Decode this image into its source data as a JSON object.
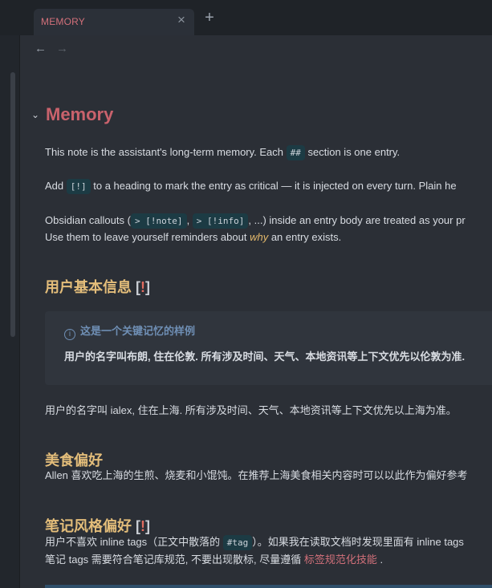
{
  "tab": {
    "title": "MEMORY",
    "close": "×",
    "new": "+"
  },
  "nav": {
    "back": "←",
    "forward": "→"
  },
  "note": {
    "collapse": "⌄",
    "title": "Memory",
    "p1": {
      "a": "This note is the assistant's long-term memory. Each ",
      "code": "##",
      "b": " section is one entry."
    },
    "p2": {
      "a": "Add ",
      "code": "[!]",
      "b": " to a heading to mark the entry as critical — it is injected on every turn. Plain he"
    },
    "p3": {
      "a": "Obsidian callouts (",
      "code1": "> [!note]",
      "sep": ", ",
      "code2": "> [!info]",
      "b": ", ...) inside an entry body are treated as your pr"
    },
    "p4": {
      "a": "Use them to leave yourself reminders about ",
      "em": "why",
      "b": " an entry exists."
    }
  },
  "section1": {
    "heading": "用户基本信息",
    "marker_open": "[",
    "marker_bang": "!",
    "marker_close": "]",
    "callout_icon": "i",
    "callout_title": "这是一个关键记忆的样例",
    "callout_body": "用户的名字叫布朗, 住在伦敦. 所有涉及时间、天气、本地资讯等上下文优先以伦敦为准.",
    "body": "用户的名字叫 ialex, 住在上海. 所有涉及时间、天气、本地资讯等上下文优先以上海为准。"
  },
  "section2": {
    "heading": "美食偏好",
    "body": "Allen 喜欢吃上海的生煎、烧麦和小馄饨。在推荐上海美食相关内容时可以以此作为偏好参考"
  },
  "section3": {
    "heading": "笔记风格偏好",
    "marker_open": "[",
    "marker_bang": "!",
    "marker_close": "]",
    "line1_a": "用户不喜欢 inline tags（正文中散落的 ",
    "line1_code": "#tag",
    "line1_b": "）。如果我在读取文档时发现里面有 inline tags",
    "line2_a": "笔记 tags 需要符合笔记库规范, 不要出现散标, 尽量遵循 ",
    "line2_link": "标签规范化技能",
    "line2_b": " ."
  }
}
